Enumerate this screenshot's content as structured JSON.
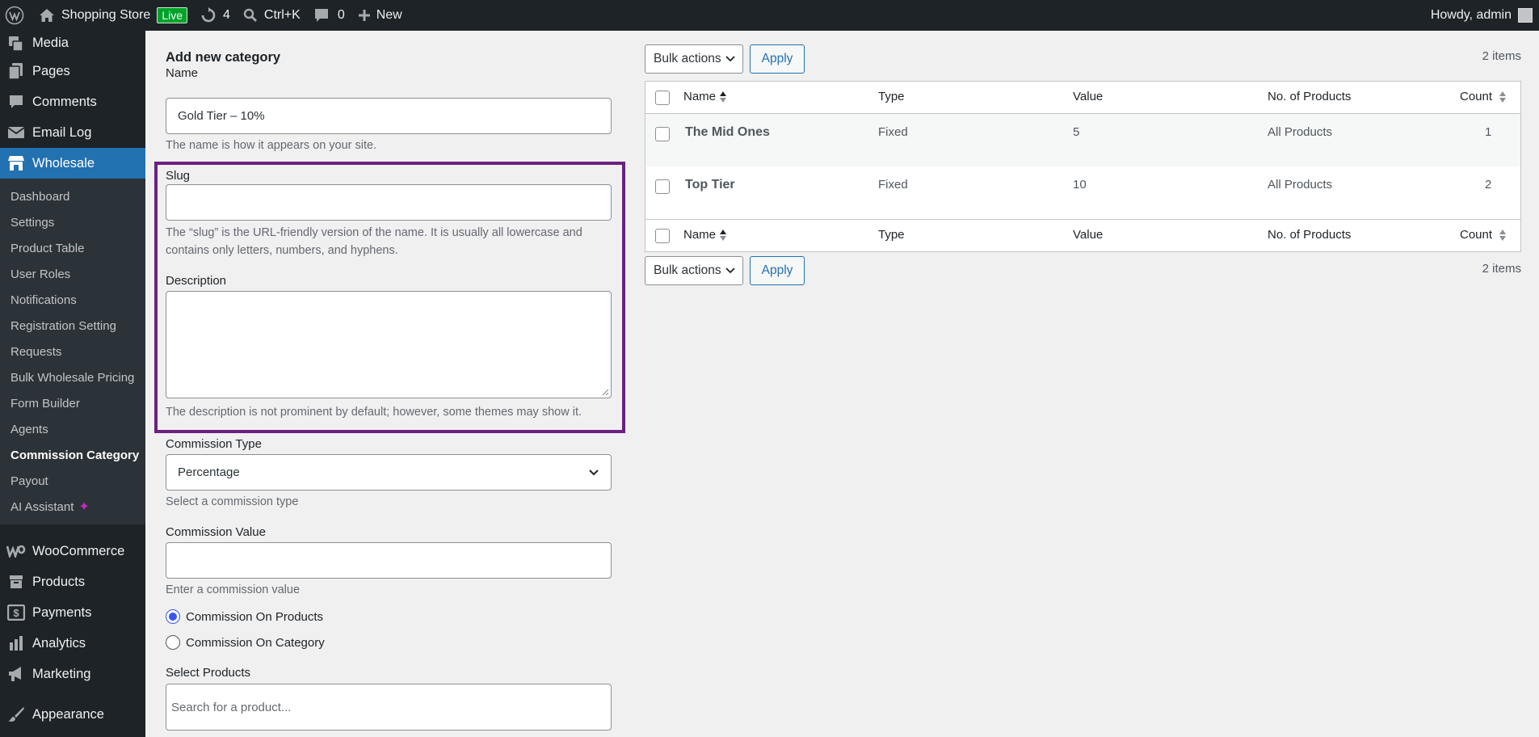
{
  "adminbar": {
    "site_name": "Shopping Store",
    "live_label": "Live",
    "updates_count": "4",
    "search_shortcut": "Ctrl+K",
    "comments_count": "0",
    "new_label": "New",
    "greeting": "Howdy, admin"
  },
  "sidebar": {
    "top_items_before": [
      {
        "label": "Media",
        "icon": "media-icon"
      },
      {
        "label": "Pages",
        "icon": "pages-icon"
      },
      {
        "label": "Comments",
        "icon": "comments-icon"
      },
      {
        "label": "Email Log",
        "icon": "email-icon"
      }
    ],
    "current": {
      "label": "Wholesale",
      "icon": "store-icon"
    },
    "submenu": [
      "Dashboard",
      "Settings",
      "Product Table",
      "User Roles",
      "Notifications",
      "Registration Setting",
      "Requests",
      "Bulk Wholesale Pricing",
      "Form Builder",
      "Agents",
      "Commission Category",
      "Payout",
      "AI Assistant"
    ],
    "submenu_current": "Commission Category",
    "top_items_after": [
      {
        "label": "WooCommerce",
        "icon": "woocommerce-icon"
      },
      {
        "label": "Products",
        "icon": "products-icon"
      },
      {
        "label": "Payments",
        "icon": "payments-icon"
      },
      {
        "label": "Analytics",
        "icon": "analytics-icon"
      },
      {
        "label": "Marketing",
        "icon": "marketing-icon"
      },
      {
        "label": "Appearance",
        "icon": "appearance-icon"
      }
    ]
  },
  "form": {
    "title": "Add new category",
    "name_label": "Name",
    "name_value": "Gold Tier – 10%",
    "name_help": "The name is how it appears on your site.",
    "slug_label": "Slug",
    "slug_value": "",
    "slug_help_1": "The “slug” is the URL-friendly version of the name. It is usually all lowercase and",
    "slug_help_2": "contains only letters, numbers, and hyphens.",
    "description_label": "Description",
    "description_help": "The description is not prominent by default; however, some themes may show it.",
    "commission_type_label": "Commission Type",
    "commission_type_value": "Percentage",
    "commission_type_help": "Select a commission type",
    "commission_value_label": "Commission Value",
    "commission_value_help": "Enter a commission value",
    "radio_products": "Commission On Products",
    "radio_category": "Commission On Category",
    "radio_selected": "products",
    "select_products_label": "Select Products",
    "select_products_placeholder": "Search for a product..."
  },
  "list": {
    "bulk_actions_label": "Bulk actions",
    "apply_label": "Apply",
    "items_count": "2 items",
    "columns": {
      "name": "Name",
      "type": "Type",
      "value": "Value",
      "products": "No. of Products",
      "count": "Count"
    },
    "rows": [
      {
        "name": "The Mid Ones",
        "type": "Fixed",
        "value": "5",
        "products": "All Products",
        "count": "1"
      },
      {
        "name": "Top Tier",
        "type": "Fixed",
        "value": "10",
        "products": "All Products",
        "count": "2"
      }
    ]
  },
  "colors": {
    "accent": "#2271b1",
    "highlight": "#6b2180",
    "sidebar_bg": "#1d2327",
    "current_menu": "#2271b1",
    "live": "#00a32a"
  }
}
